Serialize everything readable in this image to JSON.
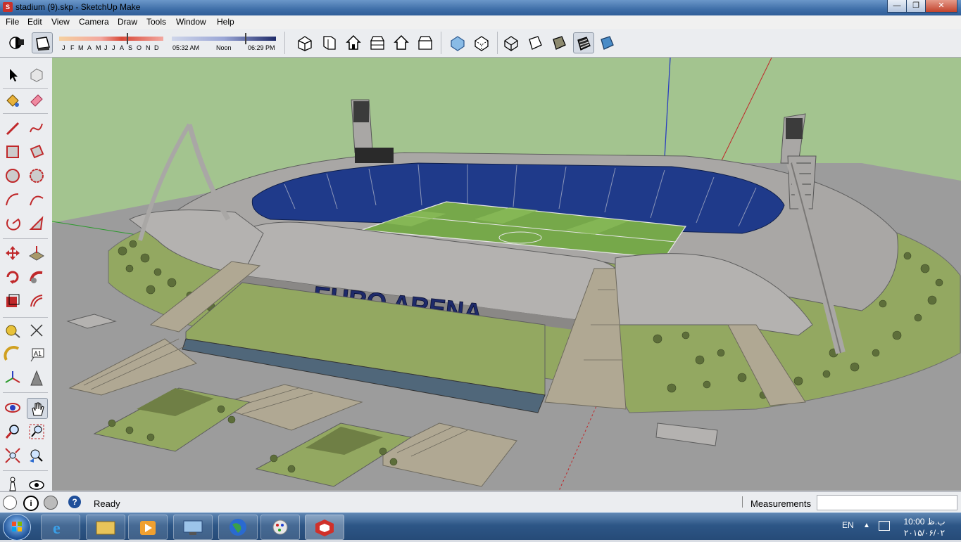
{
  "window": {
    "title": "stadium (9).skp - SketchUp Make",
    "app_icon_letter": "S"
  },
  "menu": {
    "items": [
      "File",
      "Edit",
      "View",
      "Camera",
      "Draw",
      "Tools",
      "Window",
      "Help"
    ]
  },
  "shadow_settings": {
    "months": [
      "J",
      "F",
      "M",
      "A",
      "M",
      "J",
      "J",
      "A",
      "S",
      "O",
      "N",
      "D"
    ],
    "sunrise_label": "05:32 AM",
    "noon_label": "Noon",
    "sunset_label": "06:29 PM"
  },
  "toolbar_icons": [
    "shadows-icon",
    "fog-icon",
    "iso-view-icon",
    "top-view-icon",
    "front-view-icon",
    "right-view-icon",
    "back-view-icon",
    "left-view-icon",
    "xray-icon",
    "back-edges-icon",
    "wireframe-icon",
    "hidden-line-icon",
    "shaded-icon",
    "shaded-with-textures-icon",
    "monochrome-icon"
  ],
  "left_tools": [
    "select-tool-icon",
    "make-component-icon",
    "paint-bucket-icon",
    "eraser-icon",
    "line-tool-icon",
    "freehand-icon",
    "rectangle-icon",
    "rotated-rectangle-icon",
    "circle-icon",
    "polygon-icon",
    "arc-icon",
    "two-point-arc-icon",
    "pie-icon",
    "follow-me-icon",
    "move-icon",
    "push-pull-icon",
    "rotate-icon",
    "follow-me-tool-icon",
    "scale-icon",
    "offset-icon",
    "tape-measure-icon",
    "dimension-icon",
    "protractor-icon",
    "text-icon",
    "axes-icon",
    "3d-text-icon",
    "orbit-icon",
    "pan-icon",
    "zoom-icon",
    "zoom-window-icon",
    "zoom-extents-icon",
    "previous-view-icon",
    "position-camera-icon",
    "look-around-icon"
  ],
  "scene": {
    "sign_text": "EURO ARENA",
    "colors": {
      "sky": "#a3c48f",
      "ground": "#9c9c9c",
      "grass": "#93a861",
      "seats": "#1f3a8a",
      "roof": "#a9a7a5"
    }
  },
  "status": {
    "text": "Ready",
    "measurements_label": "Measurements",
    "measurements_value": ""
  },
  "taskbar": {
    "apps": [
      "start-orb-icon",
      "internet-explorer-icon",
      "file-explorer-icon",
      "media-player-icon",
      "network-icon",
      "google-earth-icon",
      "paint-icon",
      "sketchup-icon"
    ],
    "language": "EN",
    "time": "10:00 ب.ظ",
    "date": "۲۰۱۵/۰۶/۰۲"
  }
}
